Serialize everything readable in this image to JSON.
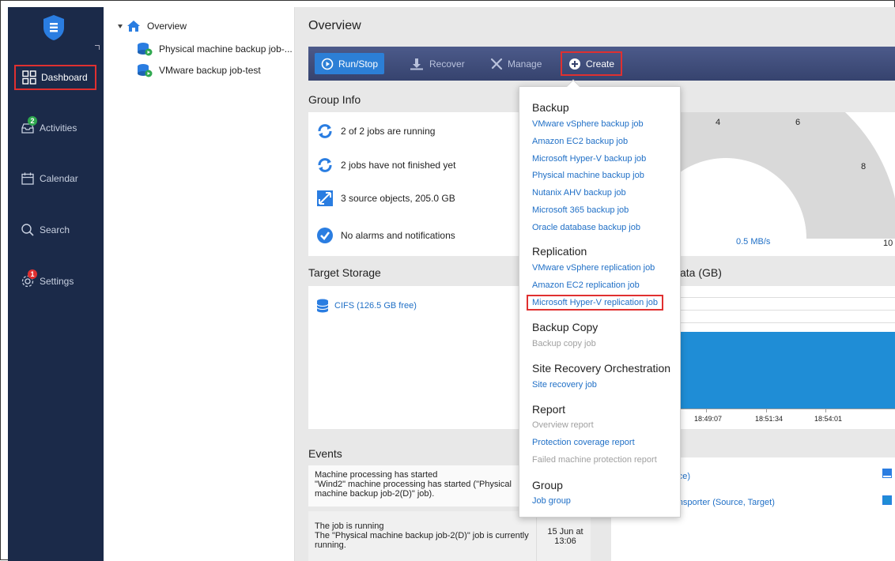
{
  "nav": {
    "items": [
      {
        "label": "Dashboard",
        "icon": "grid-icon"
      },
      {
        "label": "Activities",
        "icon": "inbox-icon",
        "badge": "2",
        "badge_color": "#2fa84f"
      },
      {
        "label": "Calendar",
        "icon": "calendar-icon"
      },
      {
        "label": "Search",
        "icon": "search-icon"
      },
      {
        "label": "Settings",
        "icon": "gear-icon",
        "badge": "1",
        "badge_color": "#e03030"
      }
    ]
  },
  "tree": {
    "root": "Overview",
    "jobs": [
      "Physical machine backup job-...",
      "VMware backup job-test"
    ]
  },
  "main": {
    "title": "Overview",
    "toolbar": {
      "run_stop": "Run/Stop",
      "recover": "Recover",
      "manage": "Manage",
      "create": "Create"
    },
    "group_info": {
      "title": "Group Info",
      "rows": [
        "2 of 2 jobs are running",
        "2 jobs have not finished yet",
        "3 source objects, 205.0 GB",
        "No alarms and notifications"
      ]
    },
    "speed": {
      "labels": [
        "4",
        "6",
        "8",
        "10"
      ],
      "value": "0.5 MB/s"
    },
    "target_storage": {
      "title": "Target Storage",
      "item": "CIFS (126.5 GB free)"
    },
    "data_panel": {
      "title_partial": "ata (GB)",
      "times": [
        "18:49:07",
        "18:51:34",
        "18:54:01"
      ]
    },
    "events": {
      "title": "Events",
      "items": [
        {
          "title": "Machine processing has started",
          "text": "\"Wind2\" machine processing has started (\"Physical machine backup job-2(D)\" job)."
        },
        {
          "title": "The job is running",
          "text": "The \"Physical machine backup job-2(D)\" job is currently running.",
          "date": "15 Jun at",
          "time": "13:06"
        }
      ]
    },
    "legend": {
      "items": [
        "urce)",
        "ransporter (Source, Target)"
      ]
    }
  },
  "create_menu": {
    "sections": [
      {
        "title": "Backup",
        "items": [
          {
            "label": "VMware vSphere backup job"
          },
          {
            "label": "Amazon EC2 backup job"
          },
          {
            "label": "Microsoft Hyper-V backup job"
          },
          {
            "label": "Physical machine backup job"
          },
          {
            "label": "Nutanix AHV backup job"
          },
          {
            "label": "Microsoft 365 backup job"
          },
          {
            "label": "Oracle database backup job"
          }
        ]
      },
      {
        "title": "Replication",
        "items": [
          {
            "label": "VMware vSphere replication job"
          },
          {
            "label": "Amazon EC2 replication job"
          },
          {
            "label": "Microsoft Hyper-V replication job"
          }
        ]
      },
      {
        "title": "Backup Copy",
        "items": [
          {
            "label": "Backup copy job"
          }
        ]
      },
      {
        "title": "Site Recovery Orchestration",
        "items": [
          {
            "label": "Site recovery job"
          }
        ]
      },
      {
        "title": "Report",
        "items": [
          {
            "label": "Overview report"
          },
          {
            "label": "Protection coverage report"
          },
          {
            "label": "Failed machine protection report"
          }
        ]
      },
      {
        "title": "Group",
        "items": [
          {
            "label": "Job group"
          }
        ]
      }
    ]
  },
  "colors": {
    "nav_bg": "#1b2a49",
    "accent": "#2c7fd6",
    "highlight": "#e03030",
    "link": "#1f6fc6"
  }
}
